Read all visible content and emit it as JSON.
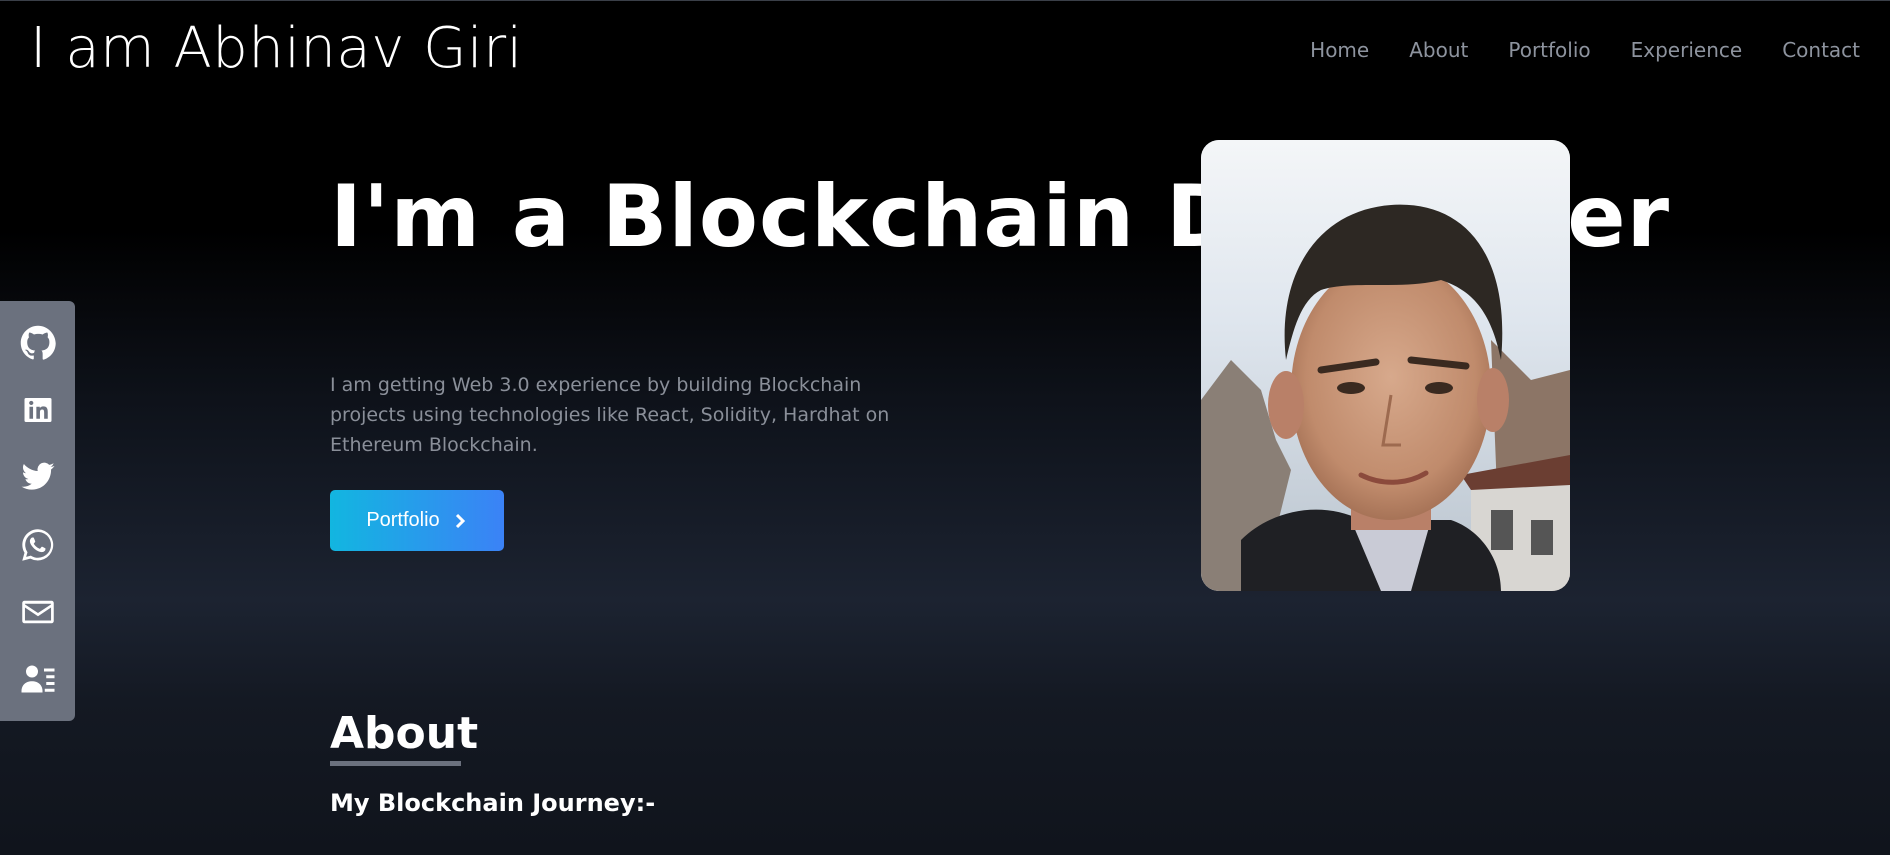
{
  "navbar": {
    "brand": "I am Abhinav Giri",
    "links": [
      "Home",
      "About",
      "Portfolio",
      "Experience",
      "Contact"
    ]
  },
  "social": [
    "github-icon",
    "linkedin-icon",
    "twitter-icon",
    "whatsapp-icon",
    "mail-icon",
    "resume-icon"
  ],
  "hero": {
    "title": "I'm a Blockchain Developer",
    "description": "I am getting Web 3.0 experience by building Blockchain projects using technologies like React, Solidity, Hardhat on Ethereum Blockchain.",
    "button_label": "Portfolio"
  },
  "about": {
    "title": "About",
    "subtitle": "My Blockchain Journey:-"
  },
  "colors": {
    "accent_start": "#12b6e0",
    "accent_end": "#3b82f6",
    "sidebar": "#6b717e",
    "muted_text": "#8a8f99"
  }
}
